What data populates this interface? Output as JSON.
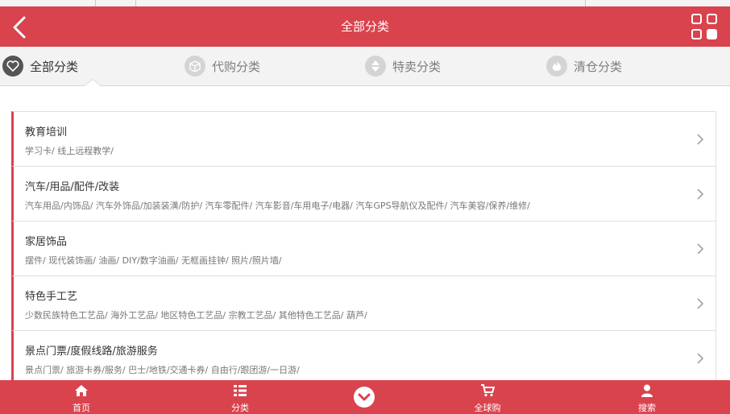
{
  "header": {
    "title": "全部分类"
  },
  "tabs": [
    {
      "label": "全部分类",
      "icon": "heart-icon",
      "active": true
    },
    {
      "label": "代购分类",
      "icon": "box-icon",
      "active": false
    },
    {
      "label": "特卖分类",
      "icon": "sort-arrows-icon",
      "active": false
    },
    {
      "label": "清仓分类",
      "icon": "flame-icon",
      "active": false
    }
  ],
  "categories": [
    {
      "name": "教育培训",
      "subs": "学习卡/ 线上远程教学/"
    },
    {
      "name": "汽车/用品/配件/改装",
      "subs": "汽车用品/内饰品/ 汽车外饰品/加装装潢/防护/ 汽车零配件/ 汽车影音/车用电子/电器/ 汽车GPS导航仪及配件/ 汽车美容/保养/维修/"
    },
    {
      "name": "家居饰品",
      "subs": "摆件/ 现代装饰画/ 油画/ DIY/数字油画/ 无框画挂钟/ 照片/照片墙/"
    },
    {
      "name": "特色手工艺",
      "subs": "少数民族特色工艺品/ 海外工艺品/ 地区特色工艺品/ 宗教工艺品/ 其他特色工艺品/ 葫芦/"
    },
    {
      "name": "景点门票/度假线路/旅游服务",
      "subs": "景点门票/ 旅游卡券/服务/ 巴士/地铁/交通卡券/ 自由行/跟团游/一日游/"
    }
  ],
  "footer": {
    "home": "首页",
    "category": "分类",
    "global": "全球购",
    "search": "搜索"
  },
  "colors": {
    "accent": "#d9434d",
    "tab_bg": "#f3f3f3"
  }
}
